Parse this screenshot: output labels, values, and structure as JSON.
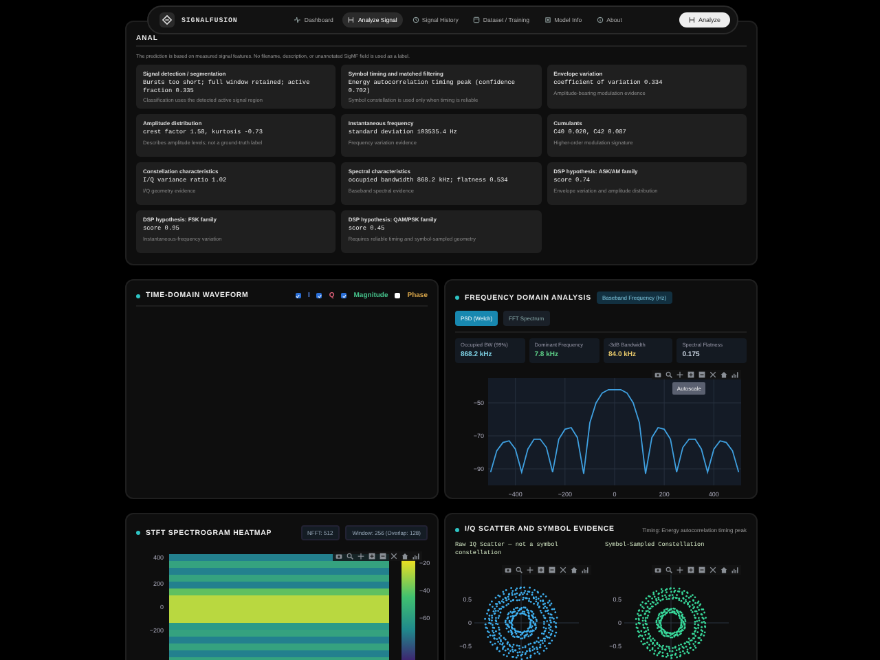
{
  "nav": {
    "brand": "SIGNALFUSION",
    "links": [
      {
        "label": "Dashboard",
        "selected": false
      },
      {
        "label": "Analyze Signal",
        "selected": true
      },
      {
        "label": "Signal History",
        "selected": false
      },
      {
        "label": "Dataset / Training",
        "selected": false
      },
      {
        "label": "Model Info",
        "selected": false
      },
      {
        "label": "About",
        "selected": false
      }
    ],
    "action": "Analyze"
  },
  "analysis": {
    "title": "ANAL",
    "note": "The prediction is based on measured signal features. No filename, description, or unannotated SigMF field is used as a label.",
    "evidence": [
      {
        "title": "Signal detection / segmentation",
        "value": "Bursts too short; full window retained; active fraction 0.335",
        "note": "Classification uses the detected active signal region"
      },
      {
        "title": "Symbol timing and matched filtering",
        "value": "Energy autocorrelation timing peak (confidence 0.702)",
        "note": "Symbol constellation is used only when timing is reliable"
      },
      {
        "title": "Envelope variation",
        "value": "coefficient of variation 0.334",
        "note": "Amplitude-bearing modulation evidence"
      },
      {
        "title": "Amplitude distribution",
        "value": "crest factor 1.58, kurtosis -0.73",
        "note": "Describes amplitude levels; not a ground-truth label"
      },
      {
        "title": "Instantaneous frequency",
        "value": "standard deviation 103535.4 Hz",
        "note": "Frequency variation evidence"
      },
      {
        "title": "Cumulants",
        "value": "C40 0.020, C42 0.087",
        "note": "Higher-order modulation signature"
      },
      {
        "title": "Constellation characteristics",
        "value": "I/Q variance ratio 1.02",
        "note": "I/Q geometry evidence"
      },
      {
        "title": "Spectral characteristics",
        "value": "occupied bandwidth 868.2 kHz; flatness 0.534",
        "note": "Baseband spectral evidence"
      },
      {
        "title": "DSP hypothesis: ASK/AM family",
        "value": "score 0.74",
        "note": "Envelope variation and amplitude distribution"
      },
      {
        "title": "DSP hypothesis: FSK family",
        "value": "score 0.95",
        "note": "Instantaneous-frequency variation"
      },
      {
        "title": "DSP hypothesis: QAM/PSK family",
        "value": "score 0.45",
        "note": "Requires reliable timing and symbol-sampled geometry"
      }
    ]
  },
  "waveform": {
    "title": "TIME-DOMAIN WAVEFORM",
    "traces": [
      {
        "label": "I",
        "checked": true,
        "color": "#5b8def"
      },
      {
        "label": "Q",
        "checked": true,
        "color": "#e0607a"
      },
      {
        "label": "Magnitude",
        "checked": true,
        "color": "#45c08a"
      },
      {
        "label": "Phase",
        "checked": false,
        "color": "#d9a64a"
      }
    ]
  },
  "frequency": {
    "title": "FREQUENCY DOMAIN ANALYSIS",
    "badge": "Baseband Frequency (Hz)",
    "tabs": [
      {
        "label": "PSD (Welch)",
        "selected": true
      },
      {
        "label": "FFT Spectrum",
        "selected": false
      }
    ],
    "stats": [
      {
        "label": "Occupied BW (99%)",
        "value": "868.2 kHz",
        "color": "#7fd3e6"
      },
      {
        "label": "Dominant Frequency",
        "value": "7.8 kHz",
        "color": "#5fd38a"
      },
      {
        "label": "-3dB Bandwidth",
        "value": "84.0 kHz",
        "color": "#e8c96a"
      },
      {
        "label": "Spectral Flatness",
        "value": "0.175",
        "color": "#c9d3e0"
      }
    ],
    "tooltip": "Autoscale",
    "chart_data": {
      "type": "line",
      "x": [
        -500,
        -475,
        -450,
        -425,
        -400,
        -375,
        -350,
        -325,
        -300,
        -275,
        -250,
        -225,
        -200,
        -175,
        -150,
        -125,
        -100,
        -75,
        -50,
        -25,
        0,
        25,
        50,
        75,
        100,
        125,
        150,
        175,
        200,
        225,
        250,
        275,
        300,
        325,
        350,
        375,
        400,
        425,
        450,
        475,
        500
      ],
      "grid": true,
      "series": [
        {
          "color": "#3fa0e0",
          "values": [
            -92,
            -79,
            -74,
            -73,
            -78,
            -92,
            -78,
            -72,
            -72,
            -77,
            -92,
            -72,
            -66,
            -65,
            -71,
            -93,
            -62,
            -50,
            -44,
            -42,
            -42,
            -42,
            -44,
            -50,
            -62,
            -93,
            -71,
            -65,
            -66,
            -72,
            -92,
            -77,
            -72,
            -72,
            -78,
            -92,
            -78,
            -73,
            -74,
            -79,
            -92
          ]
        }
      ],
      "xlim": [
        -510,
        510
      ],
      "ylim": [
        -100,
        -35
      ],
      "xticks": [
        {
          "value": -400,
          "label": "−400"
        },
        {
          "value": -200,
          "label": "−200"
        },
        0,
        200,
        400
      ],
      "yticks": [
        {
          "value": -50,
          "label": "−50"
        },
        {
          "value": -70,
          "label": "−70"
        },
        {
          "value": -90,
          "label": "−90"
        }
      ]
    }
  },
  "spectrogram": {
    "title": "STFT SPECTROGRAM HEATMAP",
    "badges": [
      "NFFT: 512",
      "Window: 256 (Overlap: 128)"
    ],
    "y_ticks": [
      "400",
      "200",
      "0",
      "−200"
    ],
    "colorbar_ticks": [
      "−20",
      "−40",
      "−60"
    ]
  },
  "scatter": {
    "title": "I/Q SCATTER AND SYMBOL EVIDENCE",
    "note": "Timing: Energy autocorrelation timing peak",
    "plots": [
      {
        "title": "Raw IQ Scatter — not a symbol constellation",
        "color": "#3fb0f0",
        "ticks": [
          "0.5",
          "0",
          "−0.5"
        ]
      },
      {
        "title": "Symbol-Sampled Constellation",
        "color": "#38d89a",
        "ticks": [
          "0.5",
          "0",
          "−0.5"
        ]
      }
    ]
  }
}
